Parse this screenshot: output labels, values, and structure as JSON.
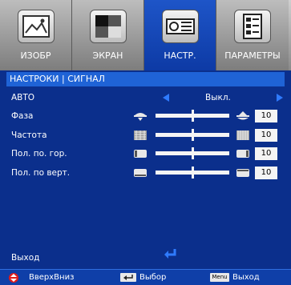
{
  "tabs": [
    {
      "label": "ИЗОБР",
      "icon": "picture-icon",
      "active": false
    },
    {
      "label": "ЭКРАН",
      "icon": "screen-icon",
      "active": false
    },
    {
      "label": "НАСТР.",
      "icon": "projector-setup-icon",
      "active": true
    },
    {
      "label": "ПАРАМЕТРЫ",
      "icon": "options-icon",
      "active": false
    }
  ],
  "header": {
    "title": "НАСТРОКИ | СИГНАЛ"
  },
  "rows": {
    "auto": {
      "label": "АВТО",
      "value": "Выкл."
    },
    "phase": {
      "label": "Фаза",
      "value": "10",
      "level": 0.5
    },
    "frequency": {
      "label": "Частота",
      "value": "10",
      "level": 0.5
    },
    "hpos": {
      "label": "Пол. по. гор.",
      "value": "10",
      "level": 0.5
    },
    "vpos": {
      "label": "Пол. по верт.",
      "value": "10",
      "level": 0.5
    }
  },
  "exit": {
    "label": "Выход"
  },
  "footer": {
    "updown_label": "ВверхВниз",
    "select_label": "Выбор",
    "menu_key": "Menu",
    "menu_label": "Выход"
  },
  "colors": {
    "background": "#0b2f8c",
    "header": "#1f63d6",
    "accent_arrow": "#2f7bff",
    "updown_icon": "#e01b1b"
  }
}
